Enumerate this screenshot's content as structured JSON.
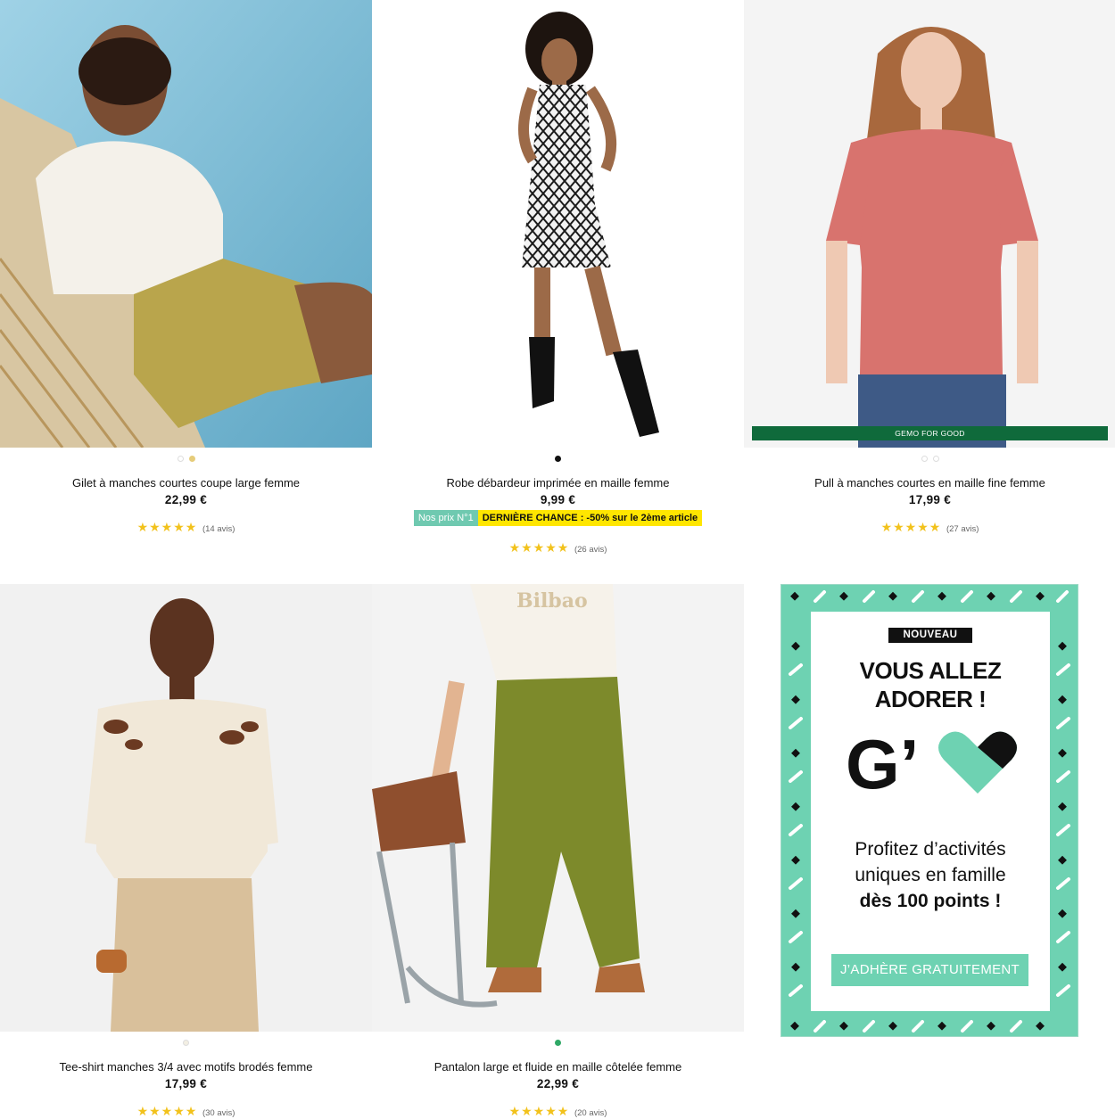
{
  "products": [
    {
      "title": "Gilet à manches courtes coupe large femme",
      "price": "22,99 €",
      "stars": "★★★★★",
      "reviews": "(14 avis)"
    },
    {
      "title": "Robe débardeur imprimée en maille femme",
      "price": "9,99 €",
      "stars": "★★★★★",
      "reviews": "(26 avis)",
      "badge_tag": "Nos prix N°1",
      "badge_offer": "DERNIÈRE CHANCE : -50% sur le 2ème article"
    },
    {
      "title": "Pull à manches courtes en maille fine femme",
      "price": "17,99 €",
      "stars": "★★★★★",
      "reviews": "(27 avis)",
      "label": "GEMO FOR GOOD"
    },
    {
      "title": "Tee-shirt manches 3/4 avec motifs brodés femme",
      "price": "17,99 €",
      "stars": "★★★★★",
      "reviews": "(30 avis)"
    },
    {
      "title": "Pantalon large et fluide en maille côtelée femme",
      "price": "22,99 €",
      "stars": "★★★★★",
      "reviews": "(20 avis)",
      "shirt_print": "Bilbao"
    }
  ],
  "promo": {
    "badge": "NOUVEAU",
    "headline_1": "VOUS ALLEZ",
    "headline_2": "ADORER !",
    "logo": "G’",
    "body_1": "Profitez d’activités",
    "body_2": "uniques en famille",
    "body_3": "dès 100 points !",
    "cta": "J’ADHÈRE GRATUITEMENT"
  },
  "colors": {
    "star": "#f2c21c",
    "promo_green": "#6ed2b2",
    "gemo_green": "#0f6a3b",
    "sale_yellow": "#ffe600"
  }
}
